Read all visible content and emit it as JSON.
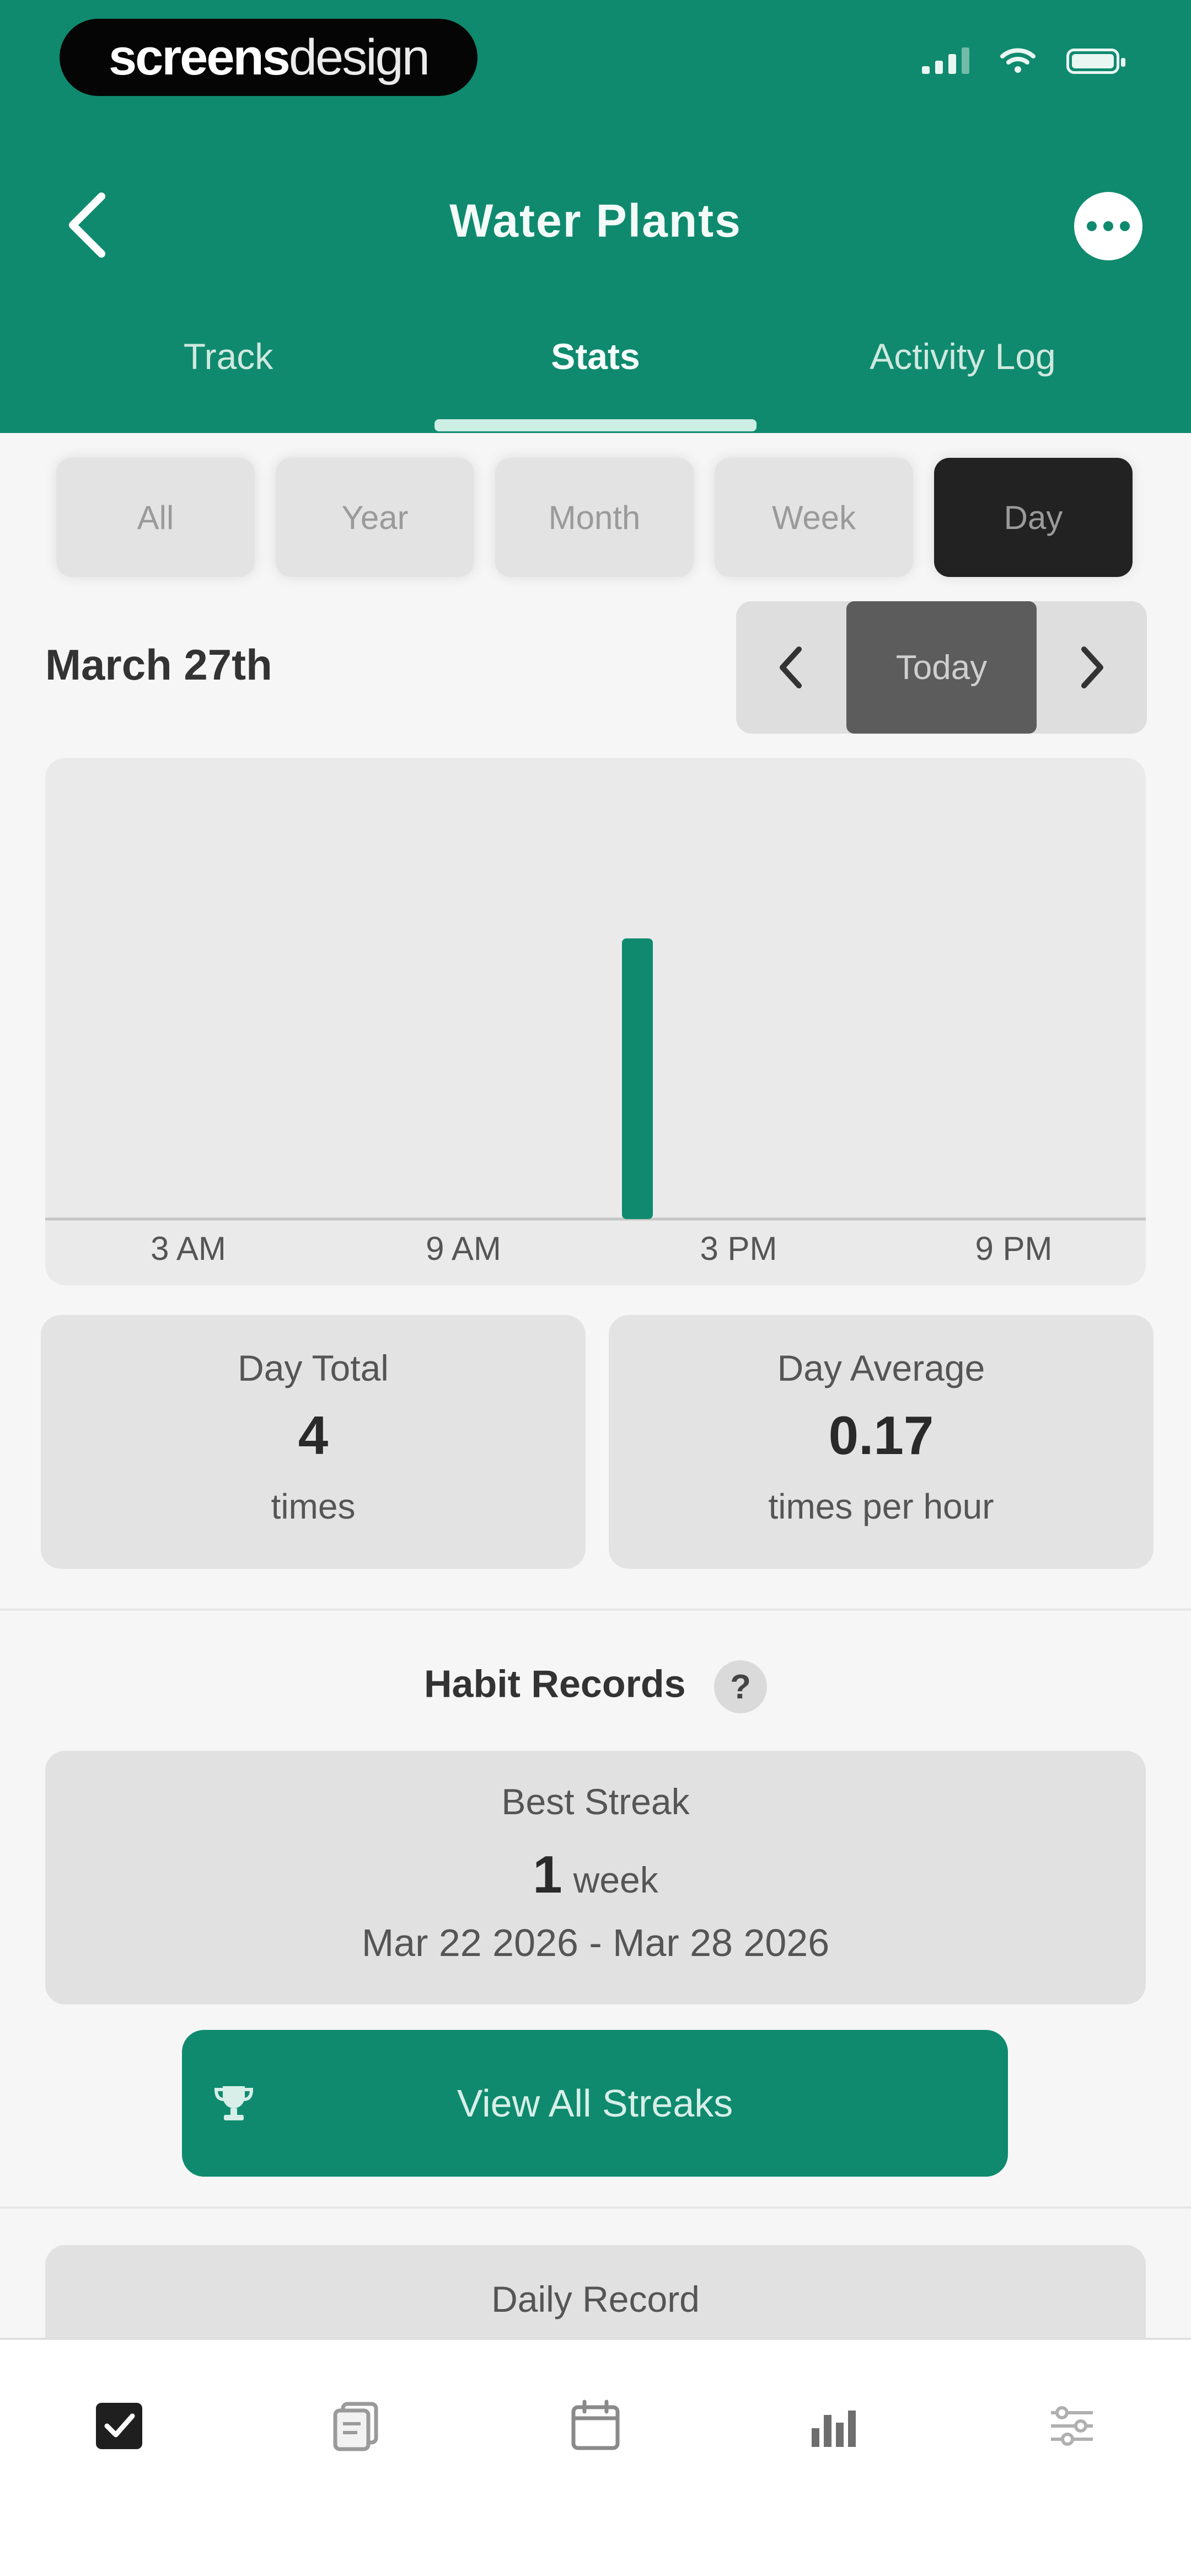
{
  "brand": {
    "part1": "screens",
    "part2": "design"
  },
  "header": {
    "title": "Water Plants"
  },
  "tabs": [
    {
      "label": "Track",
      "active": false
    },
    {
      "label": "Stats",
      "active": true
    },
    {
      "label": "Activity Log",
      "active": false
    }
  ],
  "periods": [
    {
      "label": "All",
      "active": false
    },
    {
      "label": "Year",
      "active": false
    },
    {
      "label": "Month",
      "active": false
    },
    {
      "label": "Week",
      "active": false
    },
    {
      "label": "Day",
      "active": true
    }
  ],
  "date_nav": {
    "date": "March 27th",
    "today_label": "Today"
  },
  "chart_data": {
    "type": "bar",
    "x_tick_labels": [
      "3 AM",
      "9 AM",
      "3 PM",
      "9 PM"
    ],
    "bars": [
      {
        "hour": 12,
        "value": 4
      }
    ],
    "ylim": [
      0,
      5
    ],
    "color": "#0f8a6e"
  },
  "stats": [
    {
      "label": "Day Total",
      "value": "4",
      "unit": "times"
    },
    {
      "label": "Day Average",
      "value": "0.17",
      "unit": "times per hour"
    }
  ],
  "habit_records": {
    "title": "Habit Records",
    "help_glyph": "?",
    "best_streak": {
      "label": "Best Streak",
      "value": "1",
      "unit": "week",
      "range": "Mar 22 2026 - Mar 28 2026"
    },
    "view_all_label": "View All Streaks",
    "daily_record_label": "Daily Record"
  },
  "colors": {
    "primary": "#0f8a6e",
    "active_segment": "#222222"
  },
  "bottom_nav_icons": [
    "checkbox-icon",
    "notes-icon",
    "calendar-icon",
    "stats-icon",
    "settings-icon"
  ]
}
